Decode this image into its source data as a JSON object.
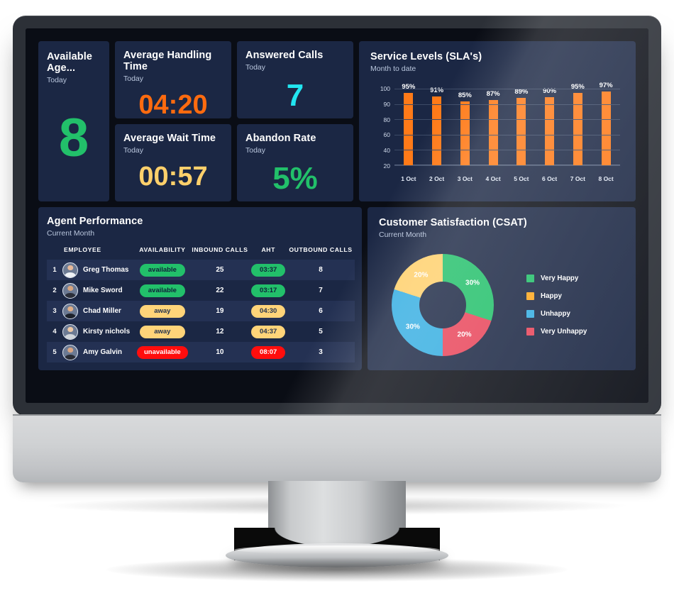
{
  "dashboard": {
    "kpis": [
      {
        "title": "Available Age...",
        "subtitle": "Today",
        "value": "8",
        "color": "#22c06a",
        "style": "v-green"
      },
      {
        "title": "Average Handling Time",
        "subtitle": "Today",
        "value": "04:20",
        "color": "#ff6b0f",
        "style": "v-orange"
      },
      {
        "title": "Answered Calls",
        "subtitle": "Today",
        "value": "7",
        "color": "#22e5f0",
        "style": "v-cyan"
      },
      {
        "title": "Average Wait Time",
        "subtitle": "Today",
        "value": "00:57",
        "color": "#ffd06b",
        "style": "v-yellow"
      },
      {
        "title": "Abandon Rate",
        "subtitle": "Today",
        "value": "5%",
        "color": "#22c06a",
        "style": "v-green"
      }
    ],
    "sla_panel": {
      "title": "Service Levels (SLA's)",
      "subtitle": "Month to date"
    },
    "agents_panel": {
      "title": "Agent Performance",
      "subtitle": "Current Month",
      "columns": [
        "EMPLOYEE",
        "AVAILABILITY",
        "INBOUND CALLS",
        "AHT",
        "OUTBOUND CALLS"
      ],
      "rows": [
        {
          "index": "1",
          "name": "Greg Thomas",
          "availability": "available",
          "availability_color": "green",
          "inbound": "25",
          "aht": "03:37",
          "aht_color": "green",
          "outbound": "8",
          "avatar_skin": "#e7b99a",
          "avatar_cloth": "#eef1f5"
        },
        {
          "index": "2",
          "name": "Mike Sword",
          "availability": "available",
          "availability_color": "green",
          "inbound": "22",
          "aht": "03:17",
          "aht_color": "green",
          "outbound": "7",
          "avatar_skin": "#d6a47f",
          "avatar_cloth": "#2b2f3a"
        },
        {
          "index": "3",
          "name": "Chad Miller",
          "availability": "away",
          "availability_color": "yellow",
          "inbound": "19",
          "aht": "04:30",
          "aht_color": "yellow",
          "outbound": "6",
          "avatar_skin": "#e0ae87",
          "avatar_cloth": "#1d222c"
        },
        {
          "index": "4",
          "name": "Kirsty nichols",
          "availability": "away",
          "availability_color": "yellow",
          "inbound": "12",
          "aht": "04:37",
          "aht_color": "yellow",
          "outbound": "5",
          "avatar_skin": "#ecc8a6",
          "avatar_cloth": "#cfd4da"
        },
        {
          "index": "5",
          "name": "Amy Galvin",
          "availability": "unavailable",
          "availability_color": "red",
          "inbound": "10",
          "aht": "08:07",
          "aht_color": "red",
          "outbound": "3",
          "avatar_skin": "#d7a483",
          "avatar_cloth": "#2a2d36"
        }
      ]
    },
    "csat_panel": {
      "title": "Customer Satisfaction (CSAT)",
      "subtitle": "Current Month"
    }
  },
  "chart_data": [
    {
      "type": "bar",
      "title": "Service Levels (SLA's)",
      "subtitle": "Month to date",
      "xlabel": "",
      "ylabel": "",
      "categories": [
        "1 Oct",
        "2 Oct",
        "3 Oct",
        "4 Oct",
        "5 Oct",
        "6 Oct",
        "7 Oct",
        "8 Oct"
      ],
      "values": [
        95,
        91,
        85,
        87,
        89,
        90,
        95,
        97
      ],
      "data_labels": [
        "95%",
        "91%",
        "85%",
        "87%",
        "89%",
        "90%",
        "95%",
        "97%"
      ],
      "ytick_labels": [
        "100",
        "90",
        "80",
        "60",
        "40",
        "20"
      ],
      "ylim": [
        10,
        100
      ],
      "bar_color": "#ff7a18",
      "grid": true,
      "legend": "none"
    },
    {
      "type": "pie",
      "title": "Customer Satisfaction (CSAT)",
      "subtitle": "Current Month",
      "donut": true,
      "legend": "right",
      "labels": [
        "Very Happy",
        "Happy",
        "Unhappy",
        "Very Unhappy"
      ],
      "legend_colors": [
        "#22c06a",
        "#ffa81e",
        "#35aee2",
        "#e8455a"
      ],
      "slices": [
        {
          "name": "Very Happy",
          "value": 30,
          "label": "30%",
          "color": "#22c06a",
          "start": 0,
          "end": 108
        },
        {
          "name": "Very Unhappy",
          "value": 20,
          "label": "20%",
          "color": "#e8455a",
          "start": 108,
          "end": 180
        },
        {
          "name": "Unhappy",
          "value": 30,
          "label": "30%",
          "color": "#35aee2",
          "start": 180,
          "end": 288
        },
        {
          "name": "Happy",
          "value": 20,
          "label": "20%",
          "color": "#ffd06b",
          "start": 288,
          "end": 360
        }
      ]
    }
  ]
}
